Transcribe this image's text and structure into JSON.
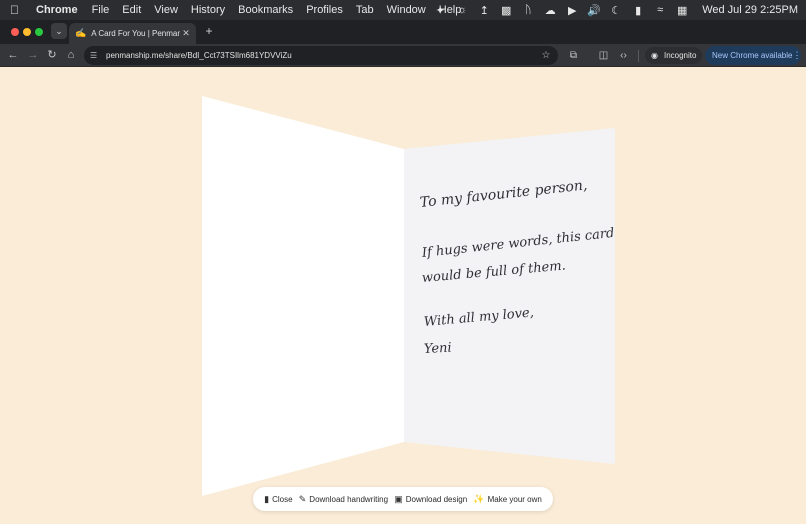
{
  "menubar": {
    "app_name": "Chrome",
    "items": [
      "File",
      "Edit",
      "View",
      "History",
      "Bookmarks",
      "Profiles",
      "Tab",
      "Window",
      "Help"
    ],
    "clock": "Wed Jul 29  2:25PM"
  },
  "browser": {
    "tab_title": "A Card For You | Penmanship",
    "url": "penmanship.me/share/BdI_Cct73TSIlm681YDVViZu",
    "incognito_label": "Incognito",
    "new_chrome_label": "New Chrome available"
  },
  "card": {
    "lines": [
      "To my favourite person,",
      "If hugs were words, this card",
      "would be full of them.",
      "With all my love,",
      "Yeni"
    ],
    "colors": {
      "background": "#faecd7",
      "left_panel": "#ffffff",
      "right_panel": "#f3f3f5",
      "ink": "#2f2f36"
    }
  },
  "actions": {
    "close": "Close",
    "download_handwriting": "Download handwriting",
    "download_design": "Download design",
    "make_your_own": "Make your own"
  }
}
